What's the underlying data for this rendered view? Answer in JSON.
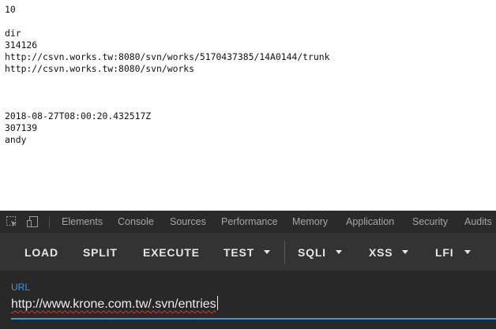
{
  "document": {
    "lines": [
      "10",
      "",
      "dir",
      "314126",
      "http://csvn.works.tw:8080/svn/works/5170437385/14A0144/trunk",
      "http://csvn.works.tw:8080/svn/works",
      "",
      "",
      "",
      "2018-08-27T08:00:20.432517Z",
      "307139",
      "andy"
    ]
  },
  "devtools": {
    "icons": [
      "inspect-element-icon",
      "device-toolbar-icon"
    ],
    "tabs": [
      "Elements",
      "Console",
      "Sources",
      "Performance",
      "Memory",
      "Application",
      "Security",
      "Audits"
    ]
  },
  "hackbar": {
    "buttons": {
      "load": "LOAD",
      "split": "SPLIT",
      "execute": "EXECUTE",
      "test": "TEST",
      "sqli": "SQLI",
      "xss": "XSS",
      "lfi": "LFI"
    },
    "url_label": "URL",
    "url_value": "http://www.krone.com.tw/.svn/entries"
  },
  "colors": {
    "accent": "#3b98e8",
    "spellcheck": "#d23434",
    "toolbar_bg": "#333333",
    "panel_bg": "#282828"
  }
}
